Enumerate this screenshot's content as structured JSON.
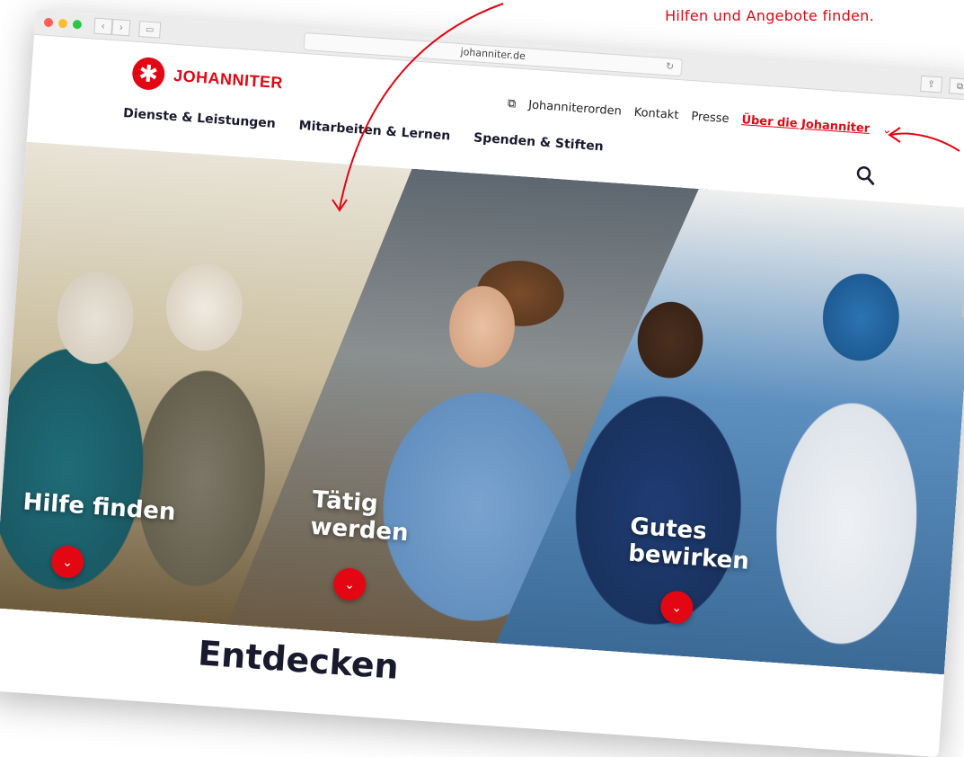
{
  "annotation": {
    "text": "Hilfen und Angebote finden."
  },
  "browser": {
    "url": "johanniter.de",
    "reload_icon": "reload-icon",
    "share_icon": "share-icon",
    "tabs_icon": "tabs-icon"
  },
  "logo": {
    "text": "JOHANNITER",
    "mark": "✱",
    "color": "#e30613"
  },
  "meta_nav": {
    "external_icon": "external-link-icon",
    "items": [
      "Johanniterorden",
      "Kontakt",
      "Presse"
    ],
    "active": "Über die Johanniter",
    "chevron": "⌄"
  },
  "main_nav": {
    "items": [
      "Dienste & Leistungen",
      "Mitarbeiten & Lernen",
      "Spenden & Stiften"
    ]
  },
  "search": {
    "icon": "search-icon"
  },
  "hero": {
    "panels": [
      {
        "label": "Hilfe finden",
        "button": "⌄"
      },
      {
        "label": "Tätig werden",
        "button": "⌄"
      },
      {
        "label": "Gutes bewirken",
        "button": "⌄"
      }
    ]
  },
  "teaser": {
    "text": "Entdecken"
  },
  "colors": {
    "brand": "#e30613",
    "navy": "#1a1a2e"
  }
}
